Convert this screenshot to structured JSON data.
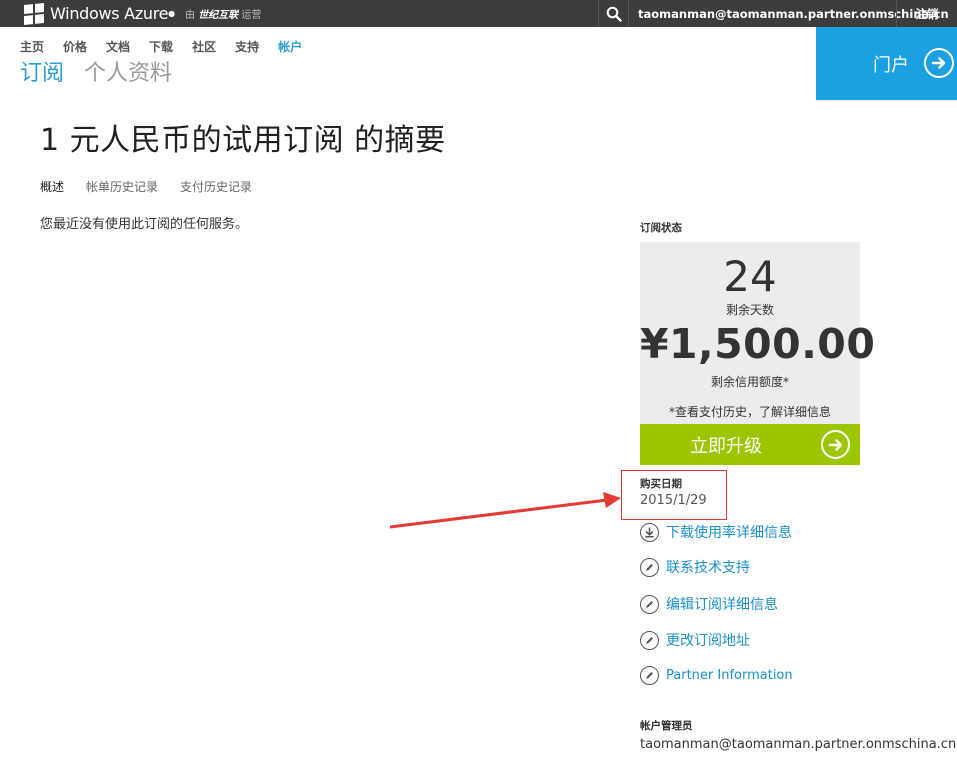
{
  "topbar": {
    "brand": "Windows Azure",
    "operator_prefix": "由",
    "operator_name": "世纪互联",
    "operator_suffix": "运营",
    "user_email": "taomanman@taomanman.partner.onmschina.cn",
    "signout": "注销"
  },
  "nav": {
    "items": [
      "主页",
      "价格",
      "文档",
      "下载",
      "社区",
      "支持",
      "帐户"
    ],
    "active_index": 6,
    "sub": [
      "订阅",
      "个人资料"
    ]
  },
  "portal": {
    "label": "门户"
  },
  "page": {
    "title": "1 元人民币的试用订阅 的摘要",
    "tabs": [
      "概述",
      "帐单历史记录",
      "支付历史记录"
    ],
    "no_usage": "您最近没有使用此订阅的任何服务。"
  },
  "status": {
    "label": "订阅状态",
    "days": "24",
    "days_label": "剩余天数",
    "credit": "¥1,500.00",
    "credit_label": "剩余信用额度*",
    "history_note": "*查看支付历史，了解详细信息",
    "upgrade": "立即升级"
  },
  "purchase": {
    "label": "购买日期",
    "date": "2015/1/29"
  },
  "links": [
    {
      "label": "下载使用率详细信息",
      "icon": "download-icon"
    },
    {
      "label": "联系技术支持",
      "icon": "pencil-icon"
    },
    {
      "label": "编辑订阅详细信息",
      "icon": "pencil-icon"
    },
    {
      "label": "更改订阅地址",
      "icon": "pencil-icon"
    },
    {
      "label": "Partner Information",
      "icon": "pencil-icon"
    }
  ],
  "admin": {
    "label": "帐户管理员",
    "email": "taomanman@taomanman.partner.onmschina.cn"
  },
  "colors": {
    "topbar": "#3c3c3c",
    "accent": "#1ba1e2",
    "upgrade": "#9bc600",
    "annotation": "#e53935"
  }
}
